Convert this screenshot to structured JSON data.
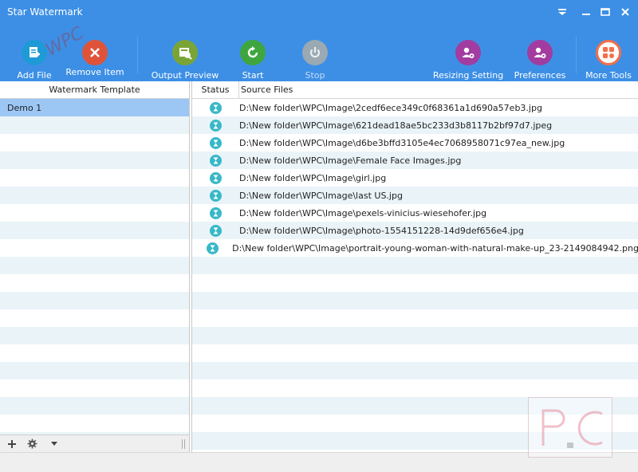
{
  "window": {
    "title": "Star Watermark",
    "controls": {
      "menu": "dropdown-icon",
      "minimize": "minimize-icon",
      "maximize": "maximize-icon",
      "close": "close-icon"
    }
  },
  "toolbar": {
    "add_file": {
      "label": "Add File",
      "icon": "add-file-icon",
      "color": "#1e9ad6"
    },
    "remove_item": {
      "label": "Remove Item",
      "icon": "remove-icon",
      "color": "#e0533b"
    },
    "output_preview": {
      "label": "Output Preview",
      "icon": "preview-icon",
      "color": "#7aa536"
    },
    "start": {
      "label": "Start",
      "icon": "start-icon",
      "color": "#3fa63f"
    },
    "stop": {
      "label": "Stop",
      "icon": "stop-icon",
      "color": "#9aa9b2",
      "disabled": true
    },
    "resizing_setting": {
      "label": "Resizing Setting",
      "icon": "resize-settings-icon",
      "color": "#a23ca0"
    },
    "preferences": {
      "label": "Preferences",
      "icon": "preferences-icon",
      "color": "#a23ca0"
    },
    "more_tools": {
      "label": "More Tools",
      "icon": "more-tools-icon",
      "color": "#f36f4a"
    }
  },
  "templates": {
    "header": "Watermark Template",
    "items": [
      "Demo 1"
    ],
    "selected_index": 0
  },
  "files": {
    "columns": {
      "status": "Status",
      "source": "Source Files"
    },
    "rows": [
      "D:\\New folder\\WPC\\Image\\2cedf6ece349c0f68361a1d690a57eb3.jpg",
      "D:\\New folder\\WPC\\Image\\621dead18ae5bc233d3b8117b2bf97d7.jpeg",
      "D:\\New folder\\WPC\\Image\\d6be3bffd3105e4ec7068958071c97ea_new.jpg",
      "D:\\New folder\\WPC\\Image\\Female Face Images.jpg",
      "D:\\New folder\\WPC\\Image\\girl.jpg",
      "D:\\New folder\\WPC\\Image\\last US.jpg",
      "D:\\New folder\\WPC\\Image\\pexels-vinicius-wiesehofer.jpg",
      "D:\\New folder\\WPC\\Image\\photo-1554151228-14d9def656e4.jpg",
      "D:\\New folder\\WPC\\Image\\portrait-young-woman-with-natural-make-up_23-2149084942.png"
    ],
    "status_icon": "hourglass-icon"
  },
  "colors": {
    "accent": "#3d8fe5",
    "selection": "#9cc7f5",
    "stripe": "#eaf4f8",
    "status_icon": "#38b8c8"
  },
  "watermark": {
    "text": "WPC",
    "logo": "P.C"
  }
}
